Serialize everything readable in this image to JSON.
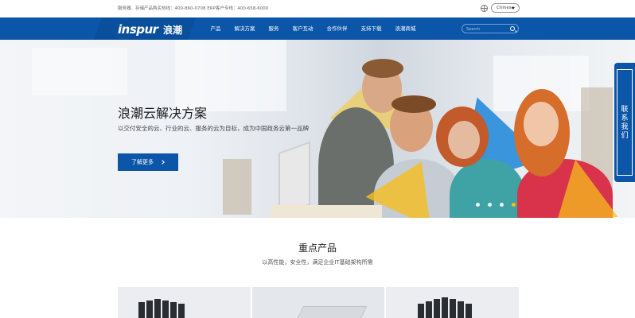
{
  "topbar": {
    "hotline": "服务器、存储产品购买热线：400-860-0708 ERP客户专线：400-658-6000",
    "language": "Chinese"
  },
  "nav": {
    "logo_text": "inspur",
    "logo_cn": "浪潮",
    "items": [
      "产品",
      "解决方案",
      "服务",
      "客户互动",
      "合作伙伴",
      "支持下载",
      "浪潮商城"
    ],
    "search_placeholder": "Search"
  },
  "hero": {
    "title": "浪潮云解决方案",
    "subtitle": "以交付安全的云、行业的云、服务的云为目标，成为中国政务云第一品牌",
    "button": "了解更多",
    "slides": 4,
    "active_slide": 4
  },
  "contact": {
    "label": "联系我们"
  },
  "products": {
    "title": "重点产品",
    "subtitle": "以高性能，安全性，满足企业IT基础架构所需"
  },
  "colors": {
    "brand_blue": "#0b56a8",
    "accent_yellow": "#f5c400"
  }
}
